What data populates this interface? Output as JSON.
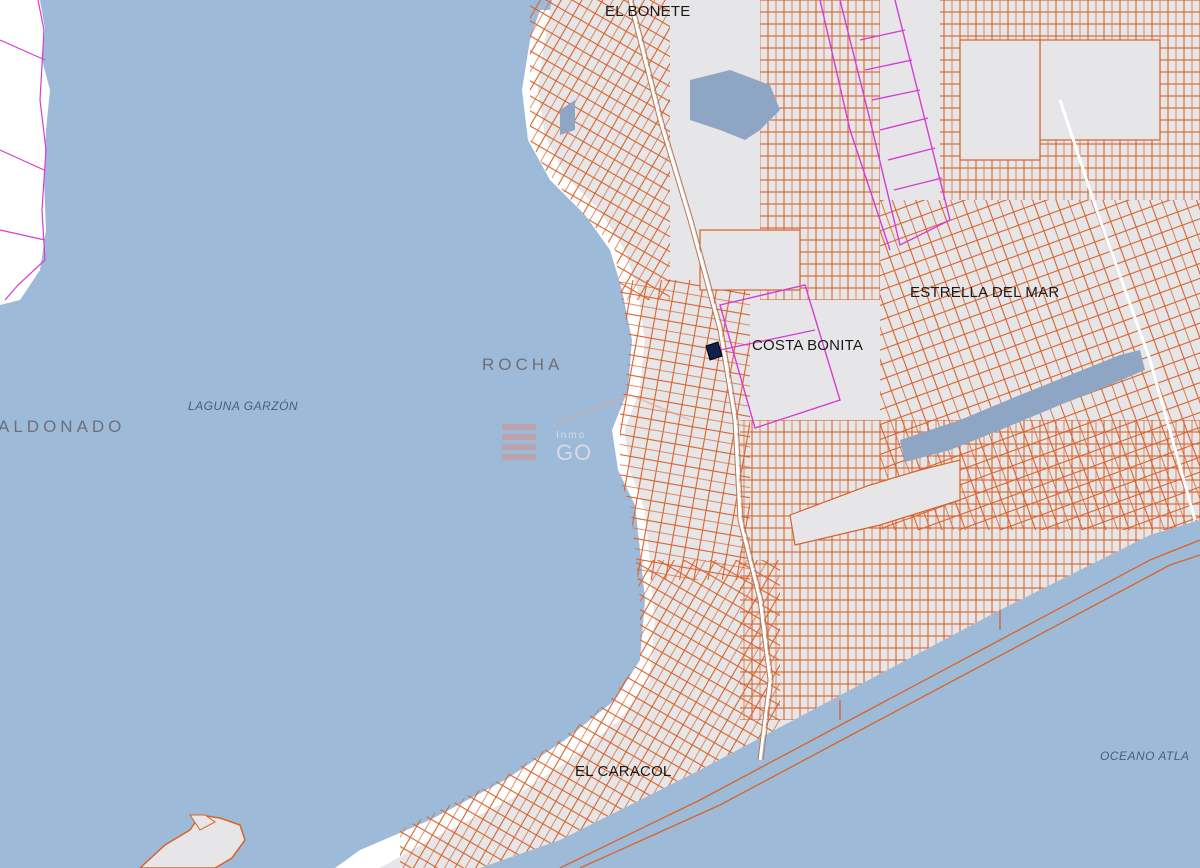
{
  "map": {
    "colors": {
      "water": "#9dbbd8",
      "land": "#e6e6e8",
      "shore_white": "#ffffff",
      "lot_lines": "#d9622a",
      "zone_lines": "#d63cd6",
      "marked_lot": "#10204a",
      "wetland": "#8ea5c4"
    },
    "labels": {
      "el_bonete": "EL BONETE",
      "estrella_del_mar": "ESTRELLA DEL MAR",
      "costa_bonita": "COSTA BONITA",
      "rocha": "ROCHA",
      "maldonado": "ALDONADO",
      "laguna_garzon": "LAGUNA GARZÓN",
      "el_caracol": "EL CARACOL",
      "oceano": "OCEANO ATLA"
    },
    "watermark": {
      "small": "Inmo",
      "brand": "GO"
    }
  }
}
